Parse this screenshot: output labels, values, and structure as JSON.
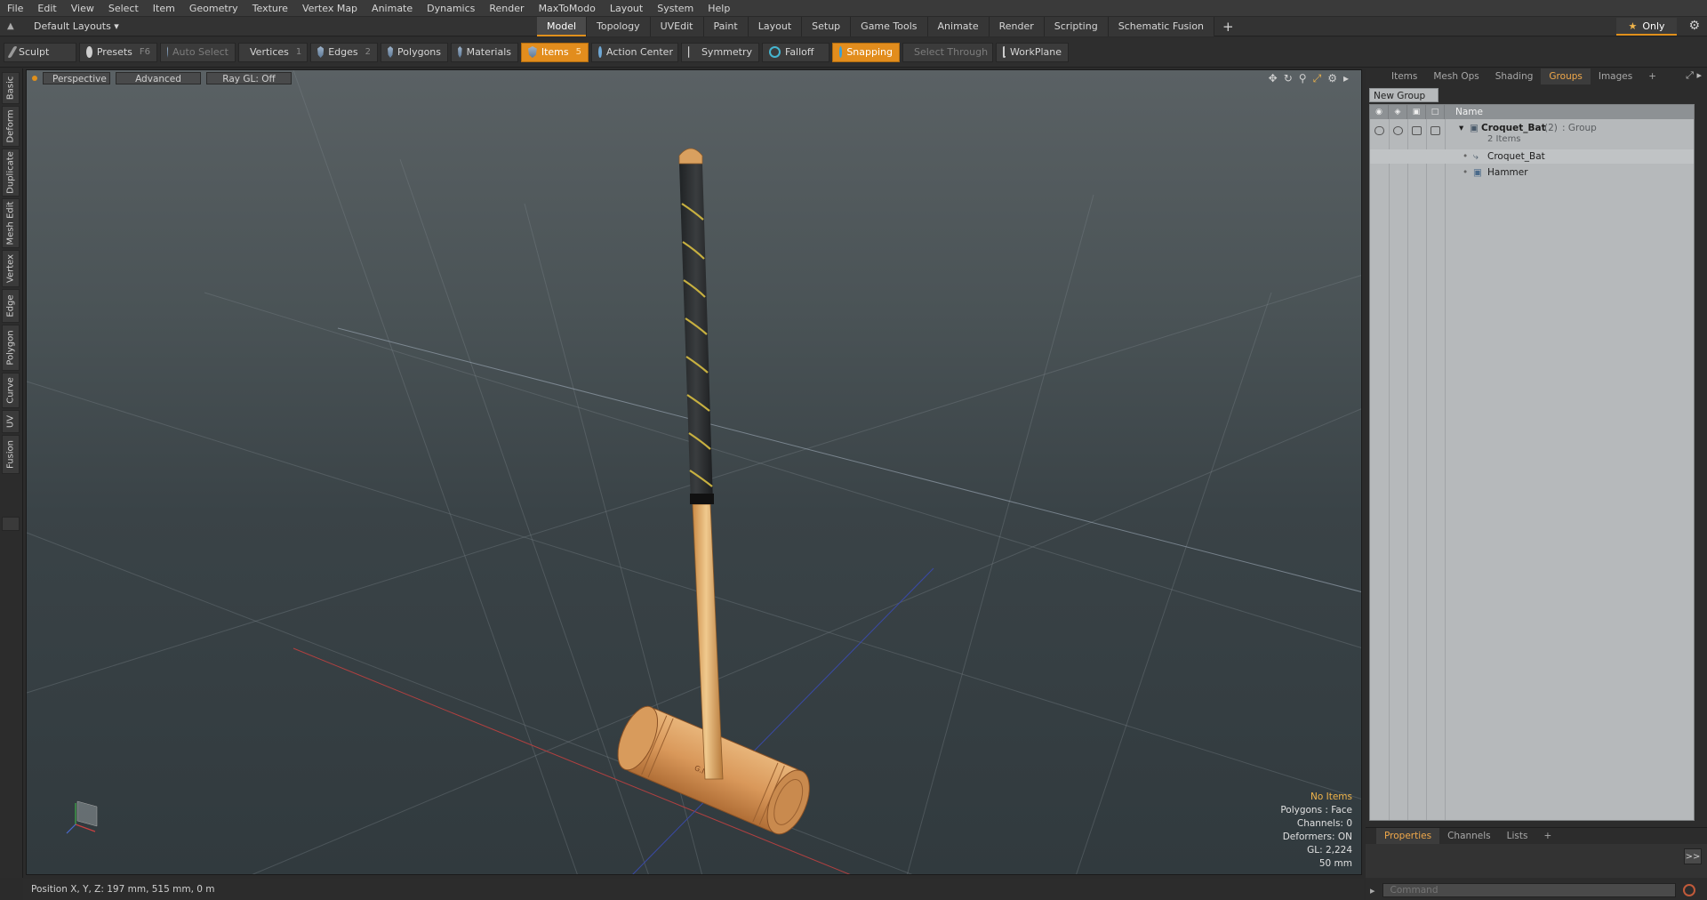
{
  "menu": [
    "File",
    "Edit",
    "View",
    "Select",
    "Item",
    "Geometry",
    "Texture",
    "Vertex Map",
    "Animate",
    "Dynamics",
    "Render",
    "MaxToModo",
    "Layout",
    "System",
    "Help"
  ],
  "layout_switch": "Default Layouts ▾",
  "mode_tabs": [
    "Model",
    "Topology",
    "UVEdit",
    "Paint",
    "Layout",
    "Setup",
    "Game Tools",
    "Animate",
    "Render",
    "Scripting",
    "Schematic Fusion"
  ],
  "only_label": "Only",
  "toolbar": {
    "sculpt": "Sculpt",
    "presets": "Presets",
    "presets_key": "F6",
    "auto_select": "Auto Select",
    "vertices": "Vertices",
    "vertices_key": "1",
    "edges": "Edges",
    "edges_key": "2",
    "polygons": "Polygons",
    "materials": "Materials",
    "items": "Items",
    "items_key": "5",
    "action_center": "Action Center",
    "symmetry": "Symmetry",
    "falloff": "Falloff",
    "snapping": "Snapping",
    "select_through": "Select Through",
    "workplane": "WorkPlane"
  },
  "left_tabs": [
    "Basic",
    "Deform",
    "Duplicate",
    "Mesh Edit",
    "Vertex",
    "Edge",
    "Polygon",
    "Curve",
    "UV",
    "Fusion"
  ],
  "viewport": {
    "view_mode": "Perspective",
    "shading": "Advanced",
    "raygl": "Ray GL: Off",
    "info": {
      "selection": "No Items",
      "polygons": "Polygons : Face",
      "channels": "Channels: 0",
      "deformers": "Deformers: ON",
      "gl": "GL: 2,224",
      "scale": "50 mm"
    }
  },
  "status": "Position X, Y, Z:  197 mm, 515 mm, 0 m",
  "right_panel": {
    "tabs": [
      "Items",
      "Mesh Ops",
      "Shading",
      "Groups",
      "Images"
    ],
    "active_tab": "Groups",
    "new_group": "New Group",
    "col_name": "Name",
    "group": {
      "name": "Croquet_Bat",
      "count": "(2)",
      "type": ": Group",
      "sub": "2 Items",
      "children": [
        "Croquet_Bat",
        "Hammer"
      ]
    },
    "bottom_tabs": [
      "Properties",
      "Channels",
      "Lists"
    ],
    "expand": ">>",
    "command_placeholder": "Command"
  },
  "colors": {
    "accent": "#e28d1d",
    "active_text": "#f0a84a",
    "wood": "#d9a05f",
    "grip": "#2d2d2d",
    "grip_stripe": "#c7b040"
  }
}
